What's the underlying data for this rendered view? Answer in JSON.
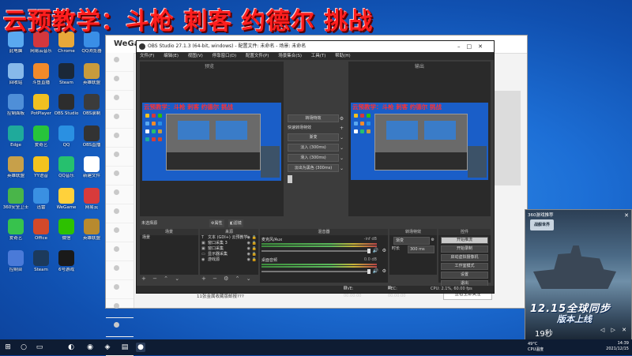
{
  "overlay_title": "云预教学：斗枪 刺客 约德尔 挑战",
  "desktop_icons": [
    {
      "label": "此电脑",
      "color": "#5aa9f0"
    },
    {
      "label": "网易云音乐",
      "color": "#d4373d"
    },
    {
      "label": "Chrome",
      "color": "#e8a83a"
    },
    {
      "label": "QQ浏览器",
      "color": "#3a8ee6"
    },
    {
      "label": "回收站",
      "color": "#87b9ea"
    },
    {
      "label": "斗鱼直播",
      "color": "#f18a2a"
    },
    {
      "label": "Steam",
      "color": "#1b2838"
    },
    {
      "label": "英雄联盟",
      "color": "#c89b3c"
    },
    {
      "label": "控制面板",
      "color": "#4f8fd8"
    },
    {
      "label": "PotPlayer",
      "color": "#f0c020"
    },
    {
      "label": "OBS Studio",
      "color": "#2d2d2d"
    },
    {
      "label": "OBS录制",
      "color": "#3b3b3b"
    },
    {
      "label": "Edge",
      "color": "#1faa9b"
    },
    {
      "label": "爱奇艺",
      "color": "#27c43b"
    },
    {
      "label": "QQ",
      "color": "#2a90e2"
    },
    {
      "label": "OBS直播",
      "color": "#333333"
    },
    {
      "label": "英雄联盟",
      "color": "#c7a04a"
    },
    {
      "label": "YY语音",
      "color": "#f3c31e"
    },
    {
      "label": "QQ音乐",
      "color": "#26c06e"
    },
    {
      "label": "新建文件",
      "color": "#ffffff"
    },
    {
      "label": "360安全卫士",
      "color": "#49b549"
    },
    {
      "label": "迅雷",
      "color": "#3a90e2"
    },
    {
      "label": "WeGame",
      "color": "#ffd13b"
    },
    {
      "label": "网易云",
      "color": "#d83b3b"
    },
    {
      "label": "爱奇艺",
      "color": "#37c24d"
    },
    {
      "label": "Office",
      "color": "#d2492a"
    },
    {
      "label": "微信",
      "color": "#2dc100"
    },
    {
      "label": "英雄联盟",
      "color": "#b88a2e"
    },
    {
      "label": "控制台",
      "color": "#4a7ad8"
    },
    {
      "label": "Steam",
      "color": "#1c3a5c"
    },
    {
      "label": "6号游戏",
      "color": "#1a1a1a"
    }
  ],
  "browser": {
    "brand": "WeGame",
    "footer_text": "11张金属收藏版邮报???",
    "more_button": "查看全部关注"
  },
  "obs": {
    "title": "OBS Studio 27.1.3 (64-bit, windows) - 配置文件: 未命名 - 场景: 未命名",
    "menu": [
      "文件(F)",
      "编辑(E)",
      "视图(V)",
      "停靠窗口(D)",
      "配置文件(P)",
      "场景集合(S)",
      "工具(T)",
      "帮助(H)"
    ],
    "preview_label": "预览",
    "program_label": "输出",
    "preview_overlay_title": "云预教学：斗枪 刺客 约德尔 挑战",
    "mid_controls": {
      "transition_btn": "转场特效",
      "quick_label": "快速转场特效",
      "items": [
        "渐变",
        "淡入 (300ms)",
        "滑入 (300ms)"
      ],
      "slide_label": "淡出为黑色 (300ms)"
    },
    "no_source": "未选择源",
    "props_btn": "属性",
    "filters_btn": "滤镜",
    "docks": {
      "scenes": "场景",
      "sources": "来源",
      "mixer": "混音器",
      "transitions": "转场特效",
      "controls": "控件"
    },
    "scenes": [
      "场景"
    ],
    "sources": [
      {
        "icon": "T",
        "label": "文本 (GDI+) 云预教学"
      },
      {
        "icon": "▣",
        "label": "窗口采集 3"
      },
      {
        "icon": "▣",
        "label": "窗口采集"
      },
      {
        "icon": "▭",
        "label": "显示器采集"
      },
      {
        "icon": "◉",
        "label": "游戏源"
      }
    ],
    "mixer": [
      {
        "name": "麦克风/Aux",
        "db": "-inf dB"
      },
      {
        "name": "桌面音频",
        "db": "0.0 dB"
      }
    ],
    "transition_type": "渐变",
    "duration_label": "时长",
    "duration_value": "300 ms",
    "controls": [
      "开始推流",
      "开始录制",
      "启动虚拟摄像机",
      "工作室模式",
      "设置",
      "退出"
    ],
    "status": {
      "live": "LIVE: 00:00:00",
      "rec": "REC: 00:00:00",
      "cpu": "CPU: 2.1%, 60.00 fps"
    }
  },
  "game_ad": {
    "top_text": "360游戏推荐",
    "logo": "战舰世界",
    "headline": "12.15全球同步",
    "subline": "版本上线",
    "countdown": "19秒",
    "controls": "◁ ▷ ✕"
  },
  "taskbar": {
    "temp": "49°C",
    "temp_label": "CPU温度",
    "time": "14:39",
    "date": "2021/12/15"
  }
}
